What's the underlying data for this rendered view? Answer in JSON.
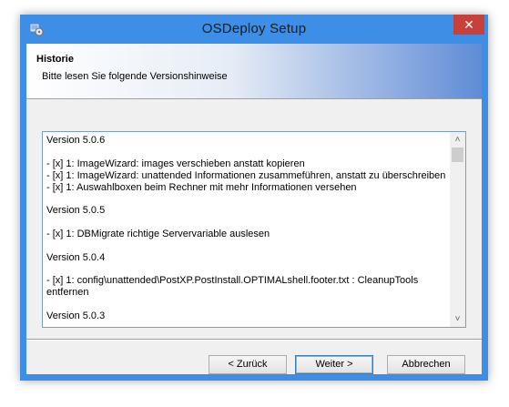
{
  "window": {
    "title": "OSDeploy Setup",
    "close_symbol": "✕",
    "icon": "setup-app-icon"
  },
  "header": {
    "title": "Historie",
    "subtitle": "Bitte lesen Sie folgende Versionshinweise"
  },
  "history": {
    "lines": [
      "Version 5.0.6",
      "",
      "- [x] 1: ImageWizard: images verschieben anstatt kopieren",
      "- [x] 1: ImageWizard: unattended Informationen zusammeführen, anstatt zu überschreiben",
      "- [x] 1: Auswahlboxen beim Rechner mit mehr Informationen versehen",
      "",
      "Version 5.0.5",
      "",
      "- [x] 1: DBMigrate richtige Servervariable auslesen",
      "",
      "Version 5.0.4",
      "",
      "- [x] 1: config\\unattended\\PostXP.PostInstall.OPTIMALshell.footer.txt : CleanupTools",
      "entfernen",
      "",
      "Version 5.0.3"
    ],
    "scroll_up_symbol": "˄",
    "scroll_down_symbol": "˅"
  },
  "buttons": {
    "back": "< Zurück",
    "next": "Weiter >",
    "cancel": "Abbrechen"
  }
}
